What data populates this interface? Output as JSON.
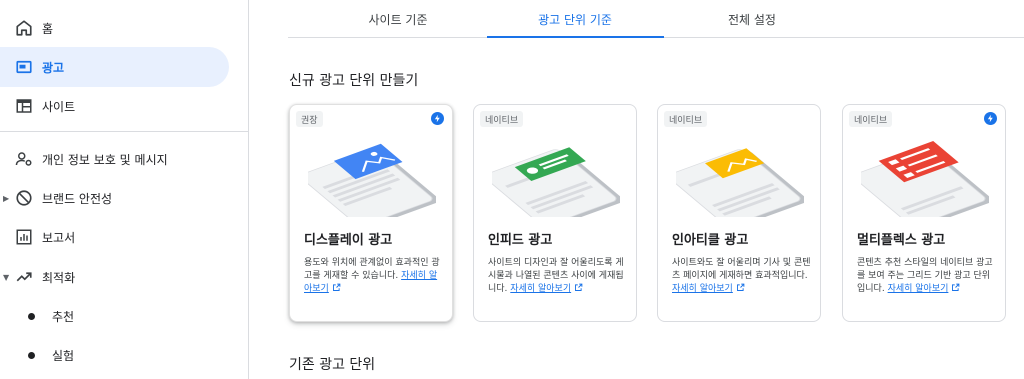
{
  "sidebar": {
    "items": [
      {
        "label": "홈",
        "icon": "home-icon"
      },
      {
        "label": "광고",
        "icon": "ads-icon"
      },
      {
        "label": "사이트",
        "icon": "sites-icon"
      },
      {
        "label": "개인 정보 보호 및 메시지",
        "icon": "privacy-icon"
      },
      {
        "label": "브랜드 안전성",
        "icon": "block-icon"
      },
      {
        "label": "보고서",
        "icon": "reports-icon"
      },
      {
        "label": "최적화",
        "icon": "trending-icon"
      },
      {
        "label": "추천",
        "icon": "dot-icon"
      },
      {
        "label": "실험",
        "icon": "dot-icon"
      }
    ],
    "active_index": 1
  },
  "tabs": [
    {
      "label": "사이트 기준"
    },
    {
      "label": "광고 단위 기준"
    },
    {
      "label": "전체 설정"
    }
  ],
  "active_tab_index": 1,
  "main": {
    "new_section_title": "신규 광고 단위 만들기",
    "existing_section_title": "기존 광고 단위",
    "cards": [
      {
        "badge": "권장",
        "title": "디스플레이 광고",
        "description": "용도와 위치에 관계없이 효과적인 광고를 게재할 수 있습니다.",
        "link": "자세히 알아보기",
        "accent": "#4285f4",
        "has_bolt": true
      },
      {
        "badge": "네이티브",
        "title": "인피드 광고",
        "description": "사이트의 디자인과 잘 어울리도록 게시물과 나열된 콘텐츠 사이에 게재됩니다.",
        "link": "자세히 알아보기",
        "accent": "#34a853",
        "has_bolt": false
      },
      {
        "badge": "네이티브",
        "title": "인아티클 광고",
        "description": "사이트와도 잘 어울리며 기사 및 콘텐츠 페이지에 게재하면 효과적입니다.",
        "link": "자세히 알아보기",
        "accent": "#fbbc04",
        "has_bolt": false
      },
      {
        "badge": "네이티브",
        "title": "멀티플렉스 광고",
        "description": "콘텐츠 추천 스타일의 네이티브 광고를 보여 주는 그리드 기반 광고 단위입니다.",
        "link": "자세히 알아보기",
        "accent": "#ea4335",
        "has_bolt": true
      }
    ]
  },
  "colors": {
    "brand_blue": "#1a73e8",
    "active_bg": "#e8f0fe",
    "border": "#dadce0"
  }
}
